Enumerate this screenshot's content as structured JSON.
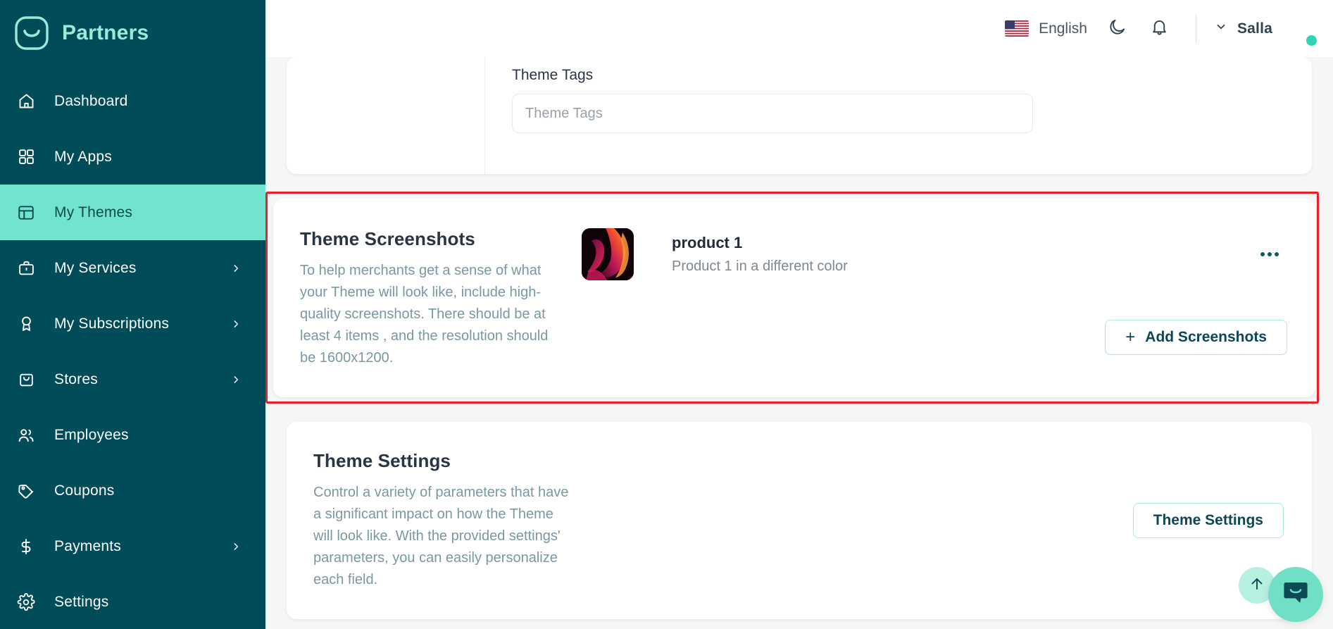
{
  "sidebar": {
    "brand": {
      "name": "Partners",
      "logo_icon": "salla-logo-icon"
    },
    "items": [
      {
        "label": "Dashboard",
        "icon": "home-icon",
        "chevron": false,
        "active": false
      },
      {
        "label": "My Apps",
        "icon": "grid-icon",
        "chevron": false,
        "active": false
      },
      {
        "label": "My Themes",
        "icon": "layout-icon",
        "chevron": false,
        "active": true
      },
      {
        "label": "My Services",
        "icon": "briefcase-icon",
        "chevron": true,
        "active": false
      },
      {
        "label": "My Subscriptions",
        "icon": "award-icon",
        "chevron": true,
        "active": false
      },
      {
        "label": "Stores",
        "icon": "shopping-bag-icon",
        "chevron": true,
        "active": false
      },
      {
        "label": "Employees",
        "icon": "users-icon",
        "chevron": false,
        "active": false
      },
      {
        "label": "Coupons",
        "icon": "tag-icon",
        "chevron": false,
        "active": false
      },
      {
        "label": "Payments",
        "icon": "dollar-icon",
        "chevron": true,
        "active": false
      },
      {
        "label": "Settings",
        "icon": "gear-icon",
        "chevron": false,
        "active": false
      }
    ]
  },
  "header": {
    "language": "English",
    "flag_icon": "us-flag-icon",
    "dark_mode_icon": "moon-icon",
    "notifications_icon": "bell-icon",
    "user_name": "Salla",
    "user_chevron_icon": "chevron-down-icon",
    "avatar_icon": "avatar"
  },
  "theme_tags": {
    "label": "Theme Tags",
    "placeholder": "Theme Tags",
    "value": ""
  },
  "theme_screenshots": {
    "title": "Theme Screenshots",
    "description": "To help merchants get a sense of what your Theme will look like, include high-quality screenshots. There should be at least 4 items , and the resolution should be 1600x1200.",
    "item": {
      "title": "product 1",
      "subtitle": "Product 1 in a different color",
      "thumbnail_icon": "screenshot-thumbnail"
    },
    "kebab_icon": "more-horizontal-icon",
    "add_button": {
      "label": "Add Screenshots",
      "plus": "+"
    },
    "highlight_color": "#e8202a"
  },
  "theme_settings": {
    "title": "Theme Settings",
    "description": "Control a variety of parameters that have a significant impact on how the Theme will look like. With the provided settings' parameters, you can easily personalize each field.",
    "button_label": "Theme Settings"
  },
  "floating": {
    "scroll_top_icon": "arrow-up-icon",
    "chat_icon": "chat-bubble-icon"
  },
  "colors": {
    "sidebar_bg": "#014c59",
    "accent": "#72e3cc",
    "brand_text": "#9ee8da",
    "page_bg": "#f5f6f6",
    "muted_text": "#7b98a1",
    "highlight_red": "#e8202a"
  }
}
